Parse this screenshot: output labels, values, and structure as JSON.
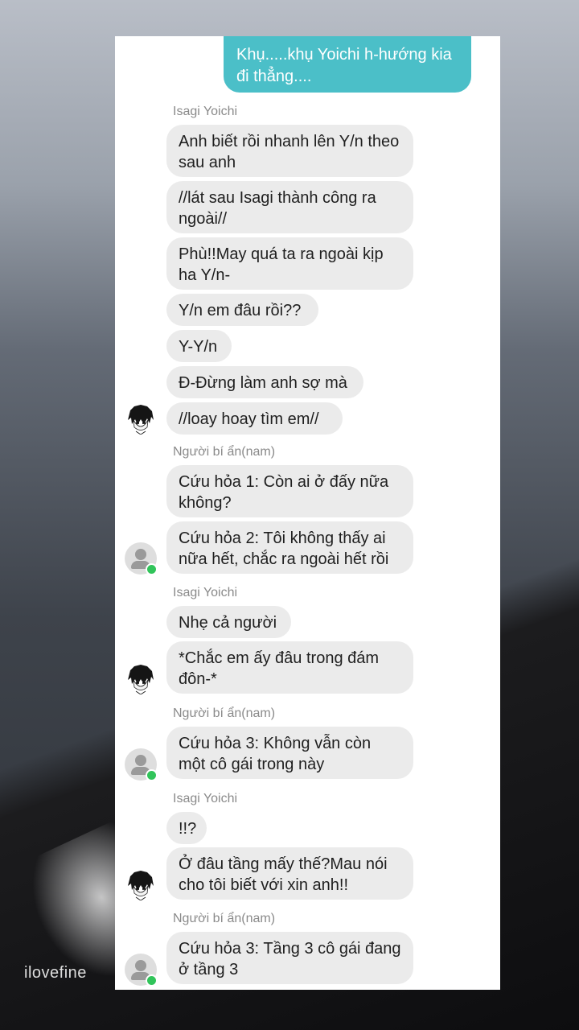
{
  "chat": {
    "sent": [
      "Khụ.....khụ Yoichi h-hướng kia đi thẳng...."
    ],
    "groups": [
      {
        "sender": "Isagi Yoichi",
        "avatar": "anime-boy-avatar",
        "messages": [
          "Anh biết rồi nhanh lên Y/n theo sau anh",
          "//lát sau Isagi thành công ra ngoài//",
          "Phù!!May quá ta ra ngoài kịp ha Y/n-",
          "Y/n em đâu rồi??",
          "Y-Y/n",
          "Đ-Đừng làm anh sợ mà",
          "//loay hoay tìm em//"
        ]
      },
      {
        "sender": "Người bí ẩn(nam)",
        "avatar": "default-user-avatar",
        "messages": [
          "Cứu hỏa 1: Còn ai ở đấy nữa không?",
          "Cứu hỏa 2: Tôi không thấy ai nữa hết, chắc ra ngoài hết rồi"
        ]
      },
      {
        "sender": "Isagi Yoichi",
        "avatar": "anime-boy-avatar",
        "messages": [
          "Nhẹ cả người",
          "*Chắc em ấy đâu trong đám đôn-*"
        ]
      },
      {
        "sender": "Người bí ẩn(nam)",
        "avatar": "default-user-avatar",
        "messages": [
          "Cứu hỏa 3: Không vẫn còn một cô gái trong này"
        ]
      },
      {
        "sender": "Isagi Yoichi",
        "avatar": "anime-boy-avatar",
        "messages": [
          "!!?",
          "Ở đâu tầng mấy thế?Mau nói cho tôi biết với xin anh!!"
        ]
      },
      {
        "sender": "Người bí ẩn(nam)",
        "avatar": "default-user-avatar",
        "messages": [
          "Cứu hỏa 3: Tầng 3 cô gái đang ở tầng 3"
        ]
      }
    ]
  },
  "watermark": "ilovefine",
  "colors": {
    "sent_bubble": "#4bbfc8",
    "received_bubble": "#ebebeb",
    "online_dot": "#31c45a"
  }
}
